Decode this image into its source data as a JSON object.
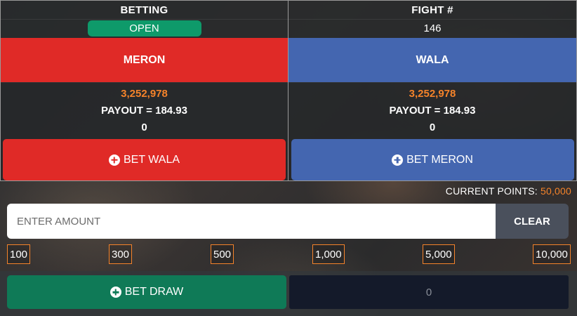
{
  "header": {
    "betting_label": "BETTING",
    "fight_label": "FIGHT #"
  },
  "status": {
    "betting_state": "OPEN",
    "fight_number": "146"
  },
  "sides": {
    "left": {
      "name": "MERON",
      "total": "3,252,978",
      "payout": "PAYOUT = 184.93",
      "my_bet": "0",
      "button_label": "BET WALA",
      "color": "#e02a27"
    },
    "right": {
      "name": "WALA",
      "total": "3,252,978",
      "payout": "PAYOUT = 184.93",
      "my_bet": "0",
      "button_label": "BET MERON",
      "color": "#4466b0"
    }
  },
  "points": {
    "label": "CURRENT POINTS:",
    "value": "50,000"
  },
  "amount": {
    "placeholder": "ENTER AMOUNT",
    "value": "",
    "clear_label": "CLEAR"
  },
  "quick_amounts": [
    "100",
    "300",
    "500",
    "1,000",
    "5,000",
    "10,000"
  ],
  "draw": {
    "button_label": "BET DRAW",
    "value": "0"
  },
  "colors": {
    "accent_orange": "#f5832a",
    "open_green": "#0e9a6a",
    "draw_green": "#0f7a57"
  },
  "icons": {
    "bet_icon": "plus-circle-icon"
  }
}
